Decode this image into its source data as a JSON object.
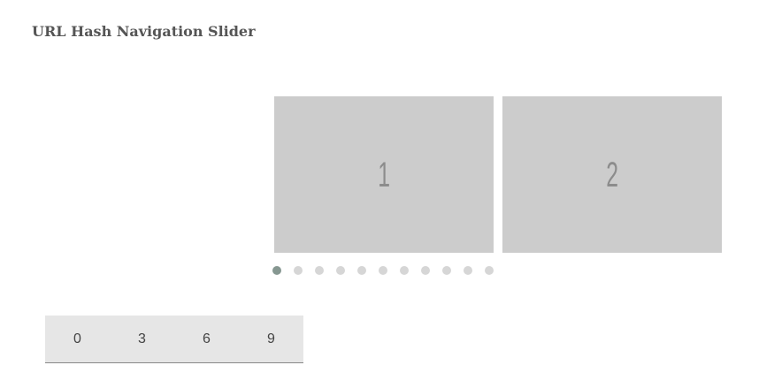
{
  "page": {
    "title": "URL Hash Navigation Slider"
  },
  "slider": {
    "slides": [
      {
        "label": "1"
      },
      {
        "label": "2"
      }
    ],
    "pagination": {
      "count": 11,
      "active_index": 0,
      "active_color": "#869791",
      "inactive_color": "#d6d6d6"
    }
  },
  "hash_nav": {
    "links": [
      "0",
      "3",
      "6",
      "9"
    ]
  },
  "colors": {
    "slide_background": "#cccccc",
    "slide_text": "#8c8c8c",
    "nav_background": "#e6e6e6"
  }
}
